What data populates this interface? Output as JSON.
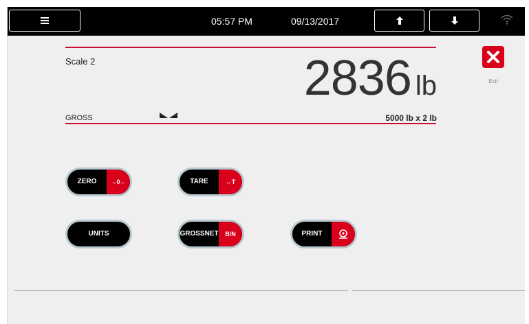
{
  "header": {
    "time": "05:57 PM",
    "date": "09/13/2017",
    "menu_icon": "hamburger-menu-icon",
    "up_icon": "arrow-up-icon",
    "down_icon": "arrow-down-icon",
    "wifi_icon": "wifi-icon"
  },
  "scale": {
    "name": "Scale 2",
    "weight": "2836",
    "unit": "lb",
    "mode": "GROSS",
    "capacity": "5000 lb x 2 lb",
    "accent_color": "#c8102e"
  },
  "exit": {
    "label": "Exit",
    "icon": "close-icon"
  },
  "buttons": {
    "zero": {
      "label": "ZERO",
      "icon_text": "→0←"
    },
    "tare": {
      "label": "TARE",
      "icon_text": "↔T"
    },
    "units": {
      "label": "UNITS"
    },
    "grossnet": {
      "label_line1": "GROSS",
      "label_line2": "NET",
      "icon_text": "B/N"
    },
    "print": {
      "label": "PRINT",
      "icon": "print-icon"
    }
  }
}
